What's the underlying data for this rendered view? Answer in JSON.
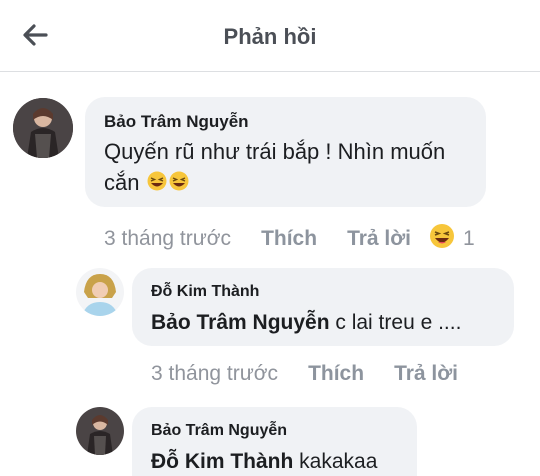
{
  "header": {
    "back_icon": "arrow-left-icon",
    "title": "Phản hồi"
  },
  "comment": {
    "author": "Bảo Trâm Nguyễn",
    "text_line1": "Quyến rũ như trái bắp ! Nhìn muốn",
    "text_line2": "cắn",
    "emoji": "grinning-squinting-face-icon",
    "time": "3 tháng trước",
    "like": "Thích",
    "reply": "Trả lời",
    "reaction_icon": "haha-reaction-icon",
    "reaction_count": "1"
  },
  "replies": [
    {
      "author": "Đỗ Kim Thành",
      "mention": "Bảo Trâm Nguyễn",
      "text": " c lai treu e ....",
      "time": "3 tháng trước",
      "like": "Thích",
      "reply": "Trả lời"
    },
    {
      "author": "Bảo Trâm Nguyễn",
      "mention": "Đỗ Kim Thành",
      "text": " kakakaa"
    }
  ],
  "colors": {
    "bubble": "#f0f2f5",
    "meta": "#90949c",
    "header_title": "#4b4f56"
  }
}
